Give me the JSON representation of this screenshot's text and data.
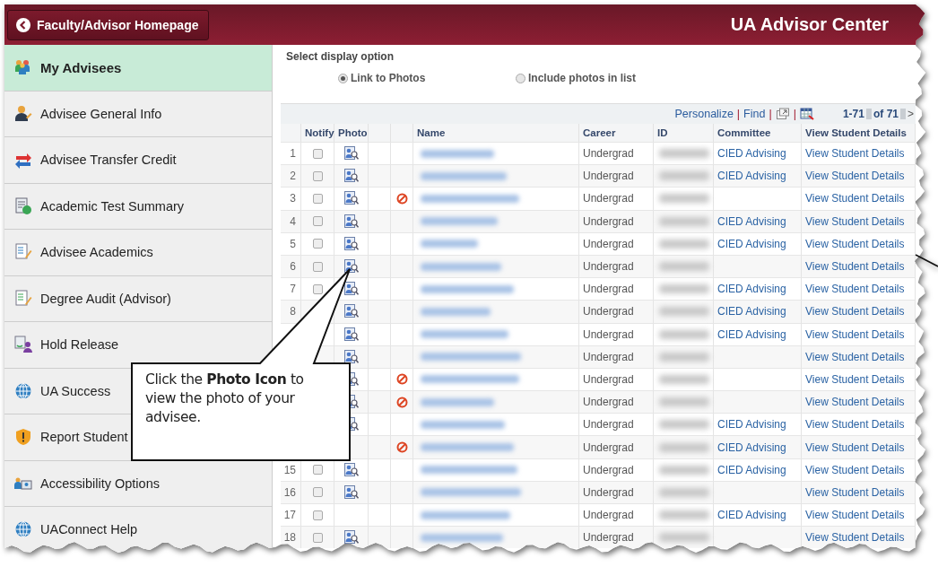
{
  "header": {
    "home_button": "Faculty/Advisor Homepage",
    "title": "UA Advisor Center"
  },
  "sidebar": {
    "items": [
      {
        "label": "My Advisees",
        "selected": true
      },
      {
        "label": "Advisee General Info",
        "selected": false
      },
      {
        "label": "Advisee Transfer Credit",
        "selected": false
      },
      {
        "label": "Academic Test Summary",
        "selected": false
      },
      {
        "label": "Advisee Academics",
        "selected": false
      },
      {
        "label": "Degree Audit (Advisor)",
        "selected": false
      },
      {
        "label": "Hold Release",
        "selected": false
      },
      {
        "label": "UA Success",
        "selected": false
      },
      {
        "label": "Report Student",
        "selected": false
      },
      {
        "label": "Accessibility Options",
        "selected": false
      },
      {
        "label": "UAConnect Help",
        "selected": false
      }
    ]
  },
  "display_option": {
    "label": "Select display option",
    "options": [
      {
        "label": "Link to Photos",
        "selected": true
      },
      {
        "label": "Include photos in list",
        "selected": false
      }
    ]
  },
  "table": {
    "toolbar": [
      {
        "kind": "link",
        "text": "Personalize"
      },
      {
        "kind": "separator",
        "text": "|"
      },
      {
        "kind": "link",
        "text": "Find"
      },
      {
        "kind": "separator",
        "text": "|"
      },
      {
        "kind": "window-button"
      },
      {
        "kind": "separator",
        "text": "|"
      },
      {
        "kind": "grid-button"
      }
    ],
    "pager": {
      "range": "1-71",
      "total": "of 71",
      "next": ">"
    },
    "columns": [
      "Notify",
      "Photo",
      "Name",
      "Career",
      "ID",
      "Committee",
      "View Student Details"
    ],
    "rows": [
      {
        "number": "1",
        "notify": false,
        "photo": true,
        "hold": false,
        "career": "Undergrad",
        "committee": "CIED Advising",
        "details": "View Student Details"
      },
      {
        "number": "2",
        "notify": false,
        "photo": true,
        "hold": false,
        "career": "Undergrad",
        "committee": "CIED Advising",
        "details": "View Student Details"
      },
      {
        "number": "3",
        "notify": false,
        "photo": true,
        "hold": true,
        "career": "Undergrad",
        "details": "View Student Details"
      },
      {
        "number": "4",
        "notify": false,
        "photo": true,
        "hold": false,
        "career": "Undergrad",
        "committee": "CIED Advising",
        "details": "View Student Details"
      },
      {
        "number": "5",
        "notify": false,
        "photo": true,
        "hold": false,
        "career": "Undergrad",
        "committee": "CIED Advising",
        "details": "View Student Details"
      },
      {
        "number": "6",
        "notify": false,
        "photo": true,
        "hold": false,
        "career": "Undergrad",
        "details": "View Student Details"
      },
      {
        "number": "7",
        "notify": false,
        "photo": true,
        "hold": false,
        "career": "Undergrad",
        "committee": "CIED Advising",
        "details": "View Student Details"
      },
      {
        "number": "8",
        "photo": true,
        "hold": false,
        "career": "Undergrad",
        "committee": "CIED Advising",
        "details": "View Student Details"
      },
      {
        "photo": true,
        "hold": false,
        "career": "Undergrad",
        "committee": "CIED Advising",
        "details": "View Student Details"
      },
      {
        "photo": true,
        "hold": false,
        "career": "Undergrad",
        "details": "View Student Details"
      },
      {
        "photo": true,
        "hold": true,
        "career": "Undergrad",
        "details": "View Student Details"
      },
      {
        "photo": true,
        "hold": true,
        "career": "Undergrad",
        "details": "View Student Details"
      },
      {
        "photo": true,
        "hold": false,
        "career": "Undergrad",
        "committee": "CIED Advising",
        "details": "View Student Details"
      },
      {
        "photo": false,
        "hold": true,
        "career": "Undergrad",
        "committee": "CIED Advising",
        "details": "View Student Details"
      },
      {
        "number": "15",
        "notify": false,
        "photo": true,
        "hold": false,
        "career": "Undergrad",
        "committee": "CIED Advising",
        "details": "View Student Details"
      },
      {
        "number": "16",
        "notify": false,
        "photo": true,
        "hold": false,
        "career": "Undergrad",
        "details": "View Student Details"
      },
      {
        "number": "17",
        "notify": false,
        "photo": false,
        "hold": false,
        "career": "Undergrad",
        "committee": "CIED Advising",
        "details": "View Student Details"
      },
      {
        "number": "18",
        "notify": false,
        "photo": true,
        "hold": false,
        "career": "Undergrad",
        "details": "View Student Details"
      }
    ]
  },
  "callout": {
    "text": "Click the **Photo Icon** to view the photo of your advisee."
  }
}
